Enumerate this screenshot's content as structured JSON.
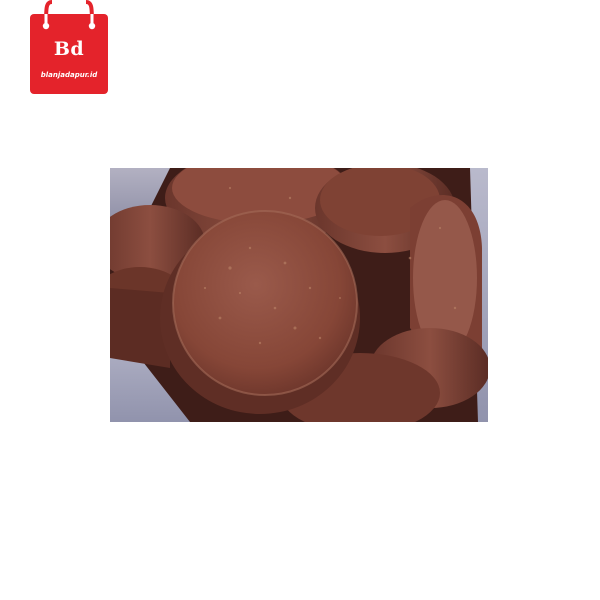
{
  "brand": {
    "initials": "Bd",
    "domain": "blanjadapur.id",
    "color": "#e4232b"
  },
  "product_photo": {
    "subject": "brown palm sugar discs"
  },
  "colors": {
    "background": "#ffffff",
    "sugar": "#8a4b3f",
    "sugar_dark": "#5a2c24",
    "plastic": "#b9bfd6"
  }
}
